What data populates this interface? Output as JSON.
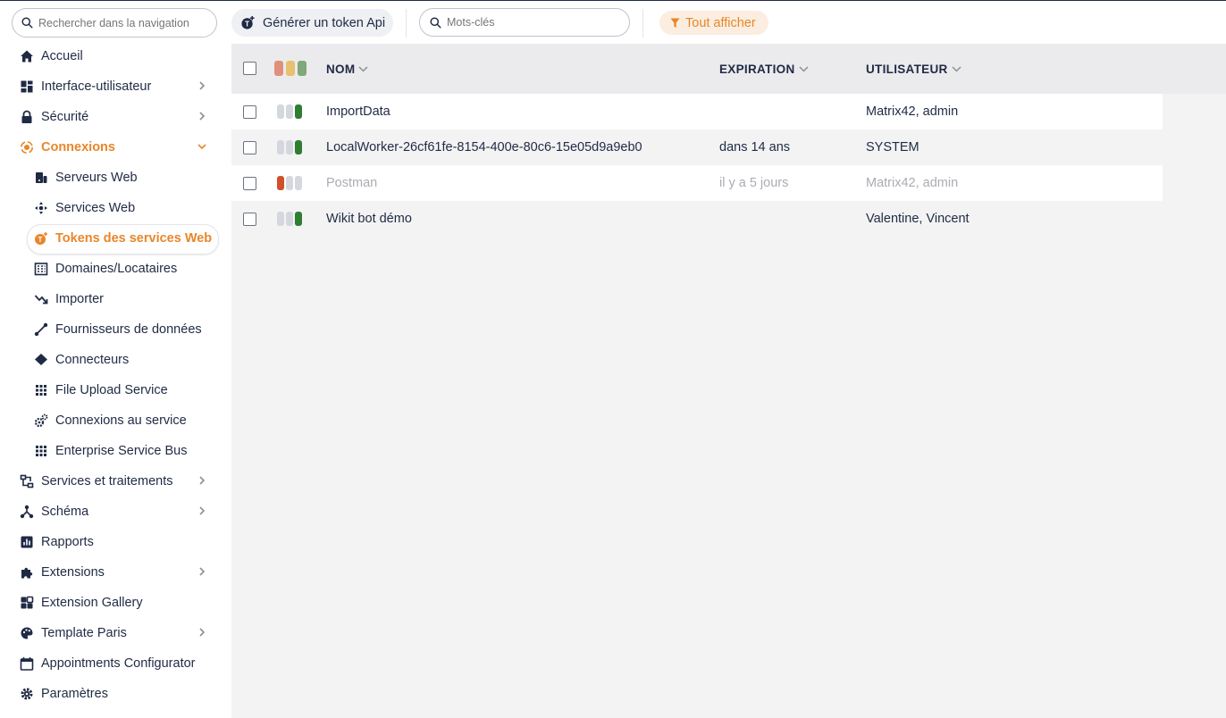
{
  "colors": {
    "accent": "#e8862a",
    "text": "#1f2a44",
    "status_red_head": "#e0907a",
    "status_yellow_head": "#e8c070",
    "status_green_head": "#80a878",
    "status_green": "#2f7d32",
    "status_red": "#d0502a",
    "status_inactive": "#d4d7de"
  },
  "sidebar": {
    "search_placeholder": "Rechercher dans la navigation",
    "items": [
      {
        "label": "Accueil",
        "icon": "home-icon",
        "chevron": false
      },
      {
        "label": "Interface-utilisateur",
        "icon": "dashboard-icon",
        "chevron": true
      },
      {
        "label": "Sécurité",
        "icon": "lock-icon",
        "chevron": true
      },
      {
        "label": "Connexions",
        "icon": "connections-icon",
        "chevron": true,
        "open": true
      },
      {
        "label": "Serveurs Web",
        "icon": "server-icon",
        "sub": true
      },
      {
        "label": "Services Web",
        "icon": "network-icon",
        "sub": true
      },
      {
        "label": "Tokens des services Web",
        "icon": "token-icon",
        "sub": true,
        "active": true
      },
      {
        "label": "Domaines/Locataires",
        "icon": "building-icon",
        "sub": true
      },
      {
        "label": "Importer",
        "icon": "import-icon",
        "sub": true
      },
      {
        "label": "Fournisseurs de données",
        "icon": "link-icon",
        "sub": true
      },
      {
        "label": "Connecteurs",
        "icon": "layers-icon",
        "sub": true
      },
      {
        "label": "File Upload Service",
        "icon": "grid-icon",
        "sub": true
      },
      {
        "label": "Connexions au service",
        "icon": "gears-icon",
        "sub": true
      },
      {
        "label": "Enterprise Service Bus",
        "icon": "grid-icon",
        "sub": true
      },
      {
        "label": "Services et traitements",
        "icon": "process-icon",
        "chevron": true
      },
      {
        "label": "Schéma",
        "icon": "schema-icon",
        "chevron": true
      },
      {
        "label": "Rapports",
        "icon": "report-icon",
        "chevron": false
      },
      {
        "label": "Extensions",
        "icon": "puzzle-icon",
        "chevron": true
      },
      {
        "label": "Extension Gallery",
        "icon": "gallery-icon",
        "chevron": false
      },
      {
        "label": "Template Paris",
        "icon": "palette-icon",
        "chevron": true
      },
      {
        "label": "Appointments Configurator",
        "icon": "calendar-icon",
        "chevron": false
      },
      {
        "label": "Paramètres",
        "icon": "gear-icon",
        "chevron": false
      }
    ]
  },
  "toolbar": {
    "generate_label": "Générer un token Api",
    "keyword_placeholder": "Mots-clés",
    "filter_label": "Tout afficher"
  },
  "table": {
    "columns": [
      "NOM",
      "EXPIRATION",
      "UTILISATEUR"
    ],
    "rows": [
      {
        "name": "ImportData",
        "expiration": "",
        "user": "Matrix42, admin",
        "status": "green",
        "muted": false
      },
      {
        "name": "LocalWorker-26cf61fe-8154-400e-80c6-15e05d9a9eb0",
        "expiration": "dans 14 ans",
        "user": "SYSTEM",
        "status": "green",
        "muted": false
      },
      {
        "name": "Postman",
        "expiration": "il y a 5 jours",
        "user": "Matrix42, admin",
        "status": "red",
        "muted": true
      },
      {
        "name": "Wikit bot démo",
        "expiration": "",
        "user": "Valentine, Vincent",
        "status": "green",
        "muted": false
      }
    ]
  }
}
